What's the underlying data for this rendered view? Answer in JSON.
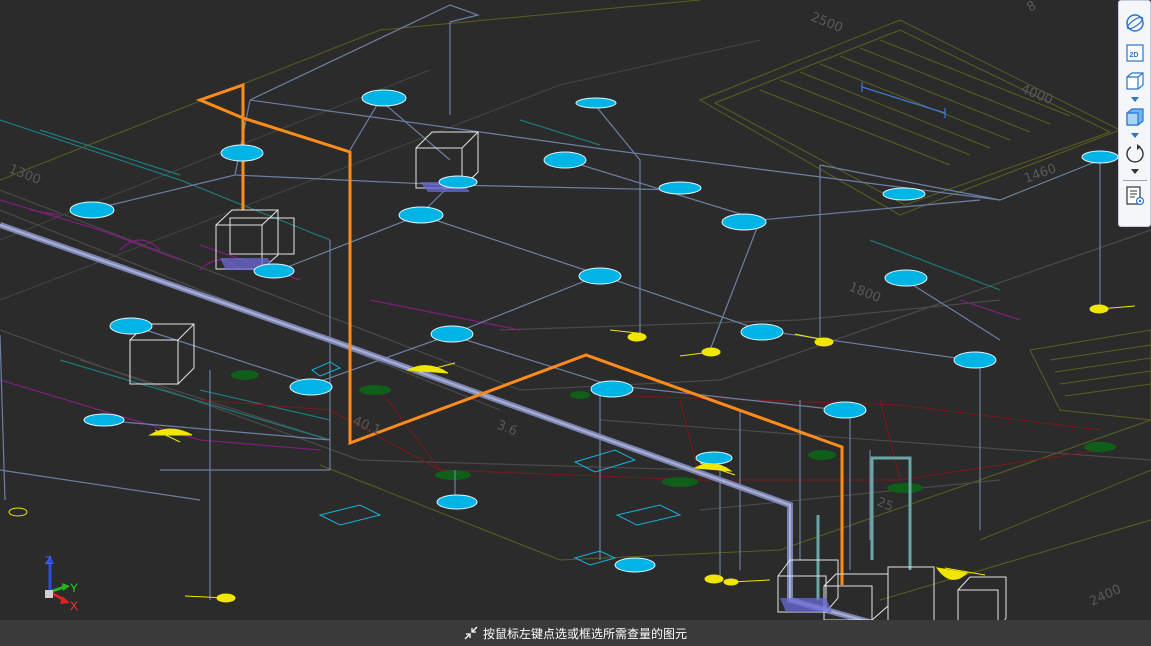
{
  "viewport": {
    "dimension_labels": {
      "d2500_top": "2500",
      "d8_top": "8",
      "d4000": "4000",
      "d1300": "1300",
      "d1460": "1460",
      "d1800": "1800",
      "d40_1": "40.1",
      "d3_6": "3.6",
      "d2400": "2400",
      "d25": "25"
    }
  },
  "axis": {
    "z": "Z",
    "y": "Y",
    "x": "X"
  },
  "toolbar": {
    "items": [
      "globe-icon",
      "2d-view",
      "cube-view",
      "cube-shaded",
      "orbit"
    ],
    "two_d_label": "2D"
  },
  "status": {
    "hint": "按鼠标左键点选或框选所需查量的图元"
  },
  "colors": {
    "background": "#2b2b2b",
    "sprinkler": "#00b4e6",
    "pipe_orange": "#ff8c1a",
    "pipe_grey": "#6d7fa3",
    "fixture_yellow": "#f0e600",
    "wall_magenta": "#8a1d8a",
    "floor_olive": "#6a6d22",
    "green_node": "#0f5f1a"
  }
}
